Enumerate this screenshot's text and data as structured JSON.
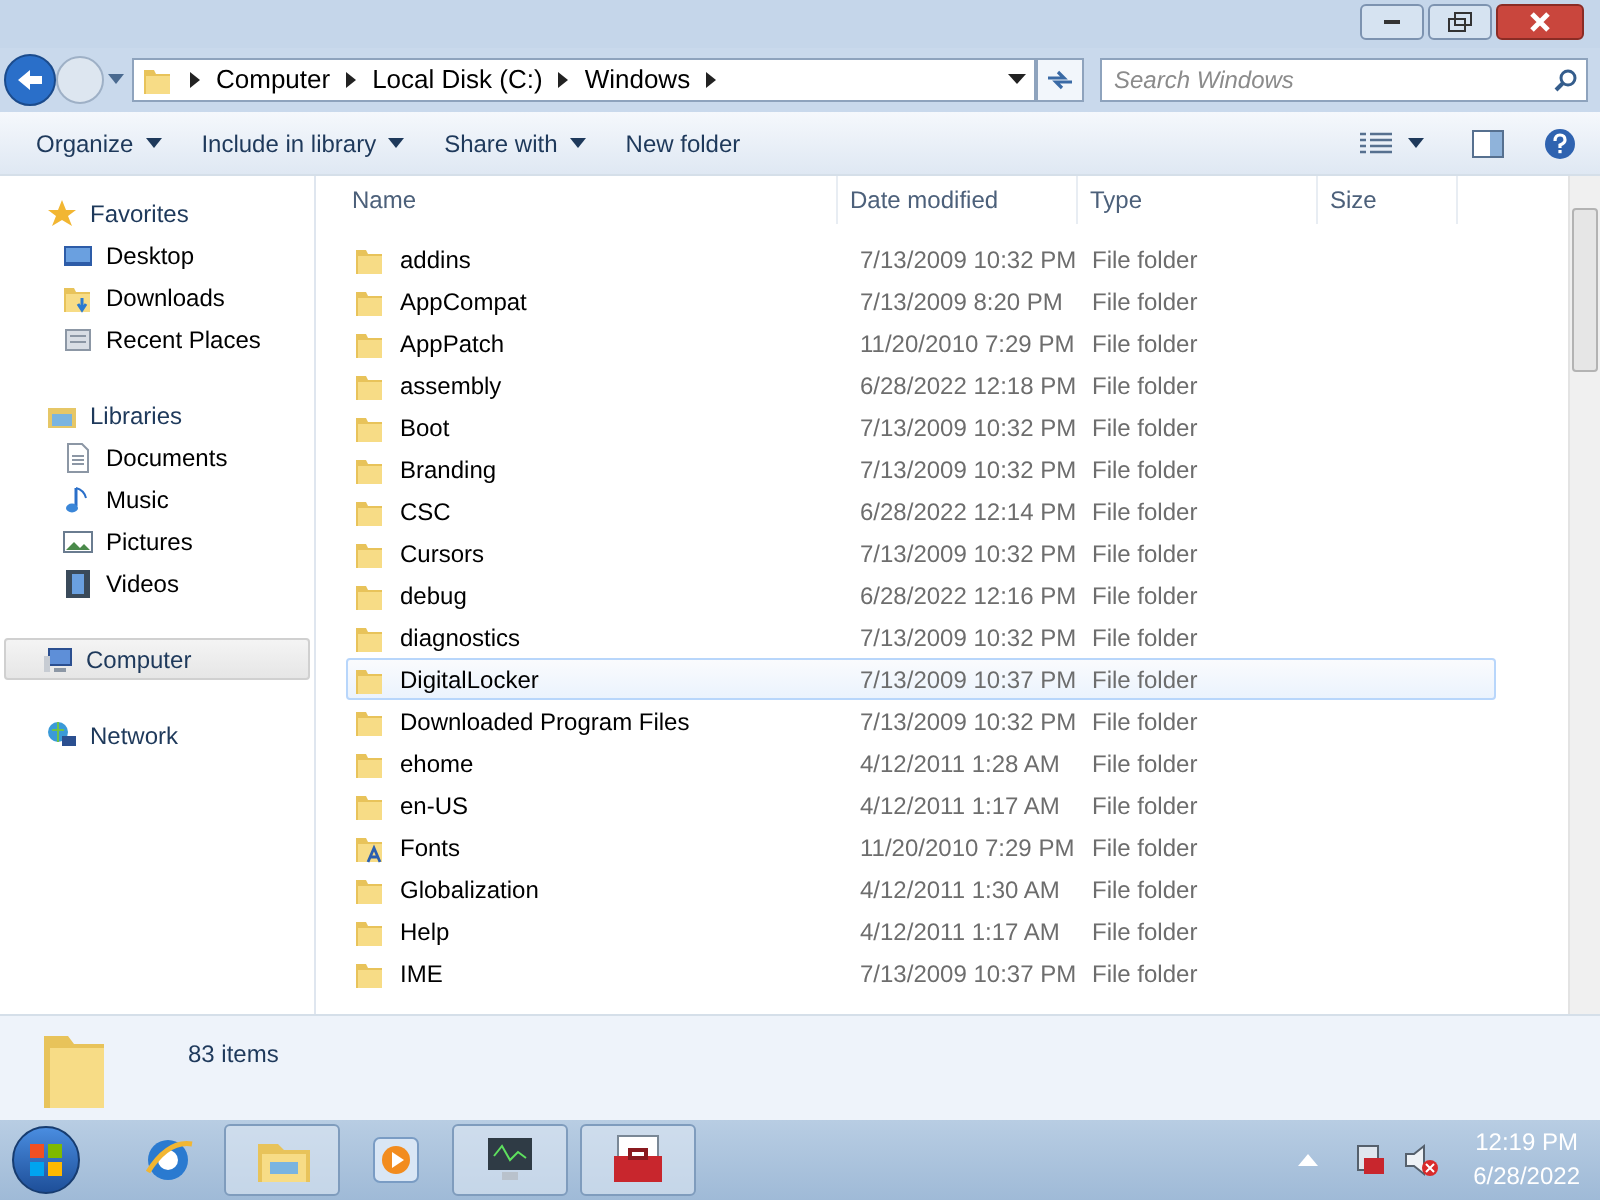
{
  "address_bar": {
    "crumbs": [
      "Computer",
      "Local Disk (C:)",
      "Windows"
    ]
  },
  "search": {
    "placeholder": "Search Windows"
  },
  "toolbar": {
    "buttons": [
      {
        "label": "Organize",
        "dropdown": true
      },
      {
        "label": "Include in library",
        "dropdown": true
      },
      {
        "label": "Share with",
        "dropdown": true
      },
      {
        "label": "New folder",
        "dropdown": false
      }
    ]
  },
  "sidebar": {
    "sections": [
      {
        "label": "Favorites",
        "selected": false,
        "children": [
          {
            "label": "Desktop"
          },
          {
            "label": "Downloads"
          },
          {
            "label": "Recent Places"
          }
        ]
      },
      {
        "label": "Libraries",
        "selected": false,
        "children": [
          {
            "label": "Documents"
          },
          {
            "label": "Music"
          },
          {
            "label": "Pictures"
          },
          {
            "label": "Videos"
          }
        ]
      },
      {
        "label": "Computer",
        "selected": true
      },
      {
        "label": "Network",
        "selected": false
      }
    ]
  },
  "table": {
    "columns": [
      "Name",
      "Date modified",
      "Type",
      "Size"
    ],
    "rows": [
      {
        "name": "addins",
        "date": "7/13/2009 10:32 PM",
        "type": "File folder",
        "kind": "folder",
        "selected": false
      },
      {
        "name": "AppCompat",
        "date": "7/13/2009 8:20 PM",
        "type": "File folder",
        "kind": "folder",
        "selected": false
      },
      {
        "name": "AppPatch",
        "date": "11/20/2010 7:29 PM",
        "type": "File folder",
        "kind": "folder",
        "selected": false
      },
      {
        "name": "assembly",
        "date": "6/28/2022 12:18 PM",
        "type": "File folder",
        "kind": "folder",
        "selected": false
      },
      {
        "name": "Boot",
        "date": "7/13/2009 10:32 PM",
        "type": "File folder",
        "kind": "folder",
        "selected": false
      },
      {
        "name": "Branding",
        "date": "7/13/2009 10:32 PM",
        "type": "File folder",
        "kind": "folder",
        "selected": false
      },
      {
        "name": "CSC",
        "date": "6/28/2022 12:14 PM",
        "type": "File folder",
        "kind": "folder",
        "selected": false
      },
      {
        "name": "Cursors",
        "date": "7/13/2009 10:32 PM",
        "type": "File folder",
        "kind": "folder",
        "selected": false
      },
      {
        "name": "debug",
        "date": "6/28/2022 12:16 PM",
        "type": "File folder",
        "kind": "folder",
        "selected": false
      },
      {
        "name": "diagnostics",
        "date": "7/13/2009 10:32 PM",
        "type": "File folder",
        "kind": "folder",
        "selected": false
      },
      {
        "name": "DigitalLocker",
        "date": "7/13/2009 10:37 PM",
        "type": "File folder",
        "kind": "folder",
        "selected": true
      },
      {
        "name": "Downloaded Program Files",
        "date": "7/13/2009 10:32 PM",
        "type": "File folder",
        "kind": "folder",
        "selected": false
      },
      {
        "name": "ehome",
        "date": "4/12/2011 1:28 AM",
        "type": "File folder",
        "kind": "folder",
        "selected": false
      },
      {
        "name": "en-US",
        "date": "4/12/2011 1:17 AM",
        "type": "File folder",
        "kind": "folder",
        "selected": false
      },
      {
        "name": "Fonts",
        "date": "11/20/2010 7:29 PM",
        "type": "File folder",
        "kind": "fonts",
        "selected": false
      },
      {
        "name": "Globalization",
        "date": "4/12/2011 1:30 AM",
        "type": "File folder",
        "kind": "folder",
        "selected": false
      },
      {
        "name": "Help",
        "date": "4/12/2011 1:17 AM",
        "type": "File folder",
        "kind": "folder",
        "selected": false
      },
      {
        "name": "IME",
        "date": "7/13/2009 10:37 PM",
        "type": "File folder",
        "kind": "folder",
        "selected": false
      }
    ]
  },
  "details_pane": {
    "count": "83 items"
  },
  "taskbar": {
    "apps": [
      {
        "active": false
      },
      {
        "active": true
      },
      {
        "active": false
      },
      {
        "active": true
      },
      {
        "active": true
      }
    ],
    "time": "12:19 PM",
    "date": "6/28/2022"
  }
}
